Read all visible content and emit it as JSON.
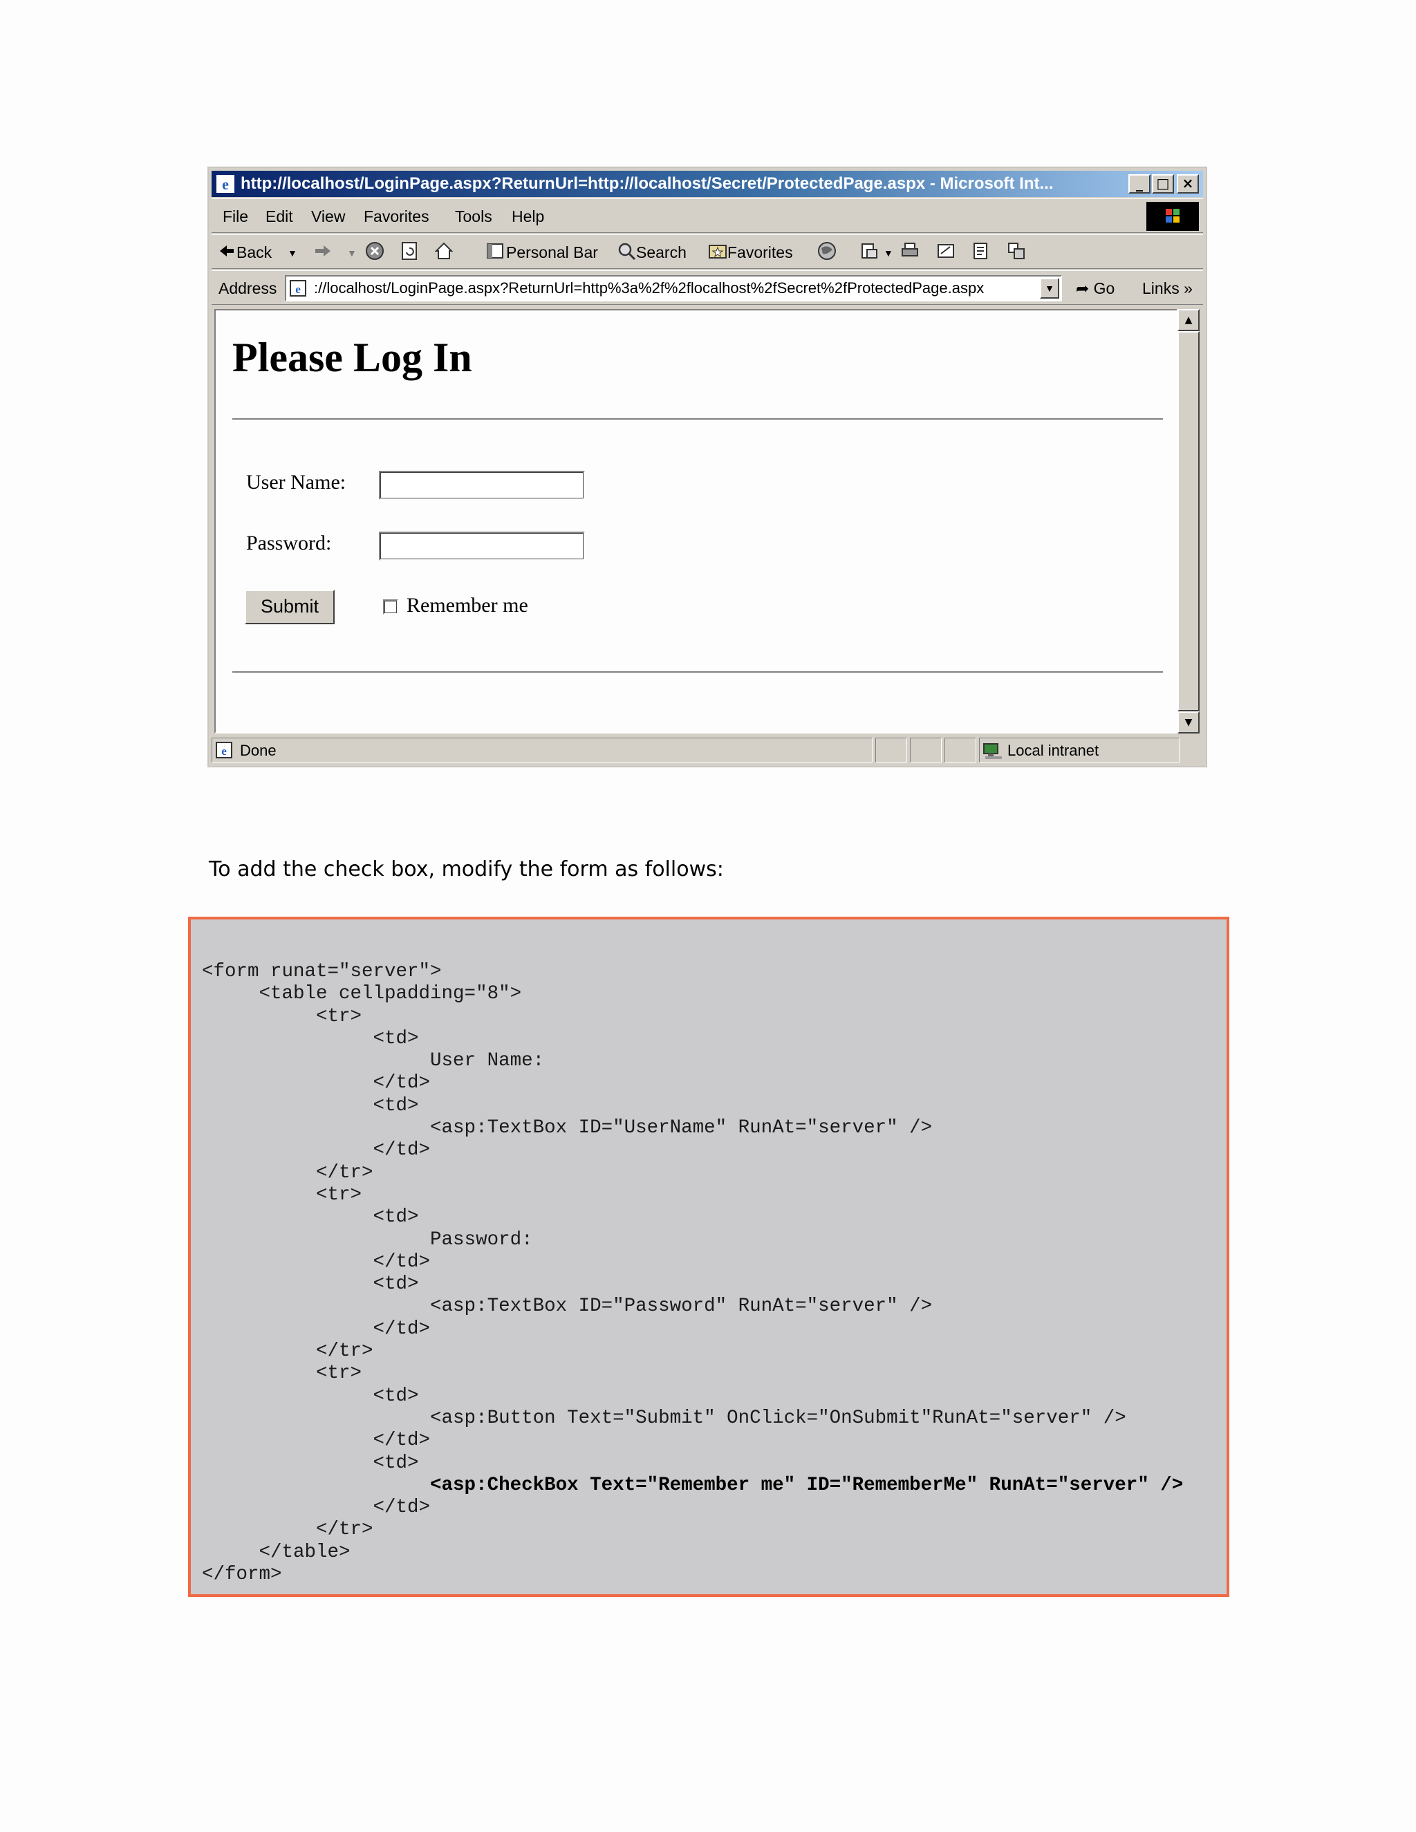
{
  "browser": {
    "title": "http://localhost/LoginPage.aspx?ReturnUrl=http://localhost/Secret/ProtectedPage.aspx - Microsoft Int...",
    "window_buttons": {
      "minimize": "_",
      "maximize": "□",
      "close": "×"
    },
    "menu": [
      "File",
      "Edit",
      "View",
      "Favorites",
      "Tools",
      "Help"
    ],
    "toolbar": {
      "back": "Back",
      "personal_bar": "Personal Bar",
      "search": "Search",
      "favorites": "Favorites"
    },
    "address": {
      "label": "Address",
      "url": "://localhost/LoginPage.aspx?ReturnUrl=http%3a%2f%2flocalhost%2fSecret%2fProtectedPage.aspx",
      "go": "Go",
      "links": "Links »"
    },
    "status": {
      "text": "Done",
      "zone": "Local intranet"
    }
  },
  "page": {
    "heading": "Please Log In",
    "username_label": "User Name:",
    "password_label": "Password:",
    "submit_label": "Submit",
    "remember_label": "Remember me"
  },
  "document": {
    "instruction": "To add the check box, modify the form as follows:",
    "code_lines": [
      "<form runat=\"server\">",
      "     <table cellpadding=\"8\">",
      "          <tr>",
      "               <td>",
      "                    User Name:",
      "               </td>",
      "               <td>",
      "                    <asp:TextBox ID=\"UserName\" RunAt=\"server\" />",
      "               </td>",
      "          </tr>",
      "          <tr>",
      "               <td>",
      "                    Password:",
      "               </td>",
      "               <td>",
      "                    <asp:TextBox ID=\"Password\" RunAt=\"server\" />",
      "               </td>",
      "          </tr>",
      "          <tr>",
      "               <td>",
      "                    <asp:Button Text=\"Submit\" OnClick=\"OnSubmit\"RunAt=\"server\" />",
      "               </td>",
      "               <td>",
      "                    <asp:CheckBox Text=\"Remember me\" ID=\"RememberMe\" RunAt=\"server\" />",
      "               </td>",
      "          </tr>",
      "     </table>",
      "</form>"
    ],
    "highlight_line": 23,
    "colors": {
      "code_border": "#f06b44",
      "code_background": "#cbcbcd"
    }
  }
}
